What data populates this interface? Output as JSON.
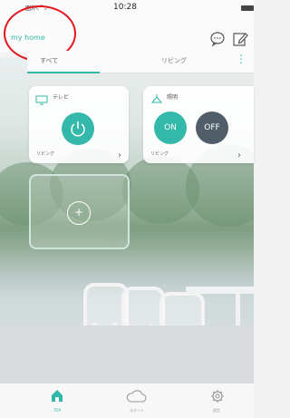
{
  "status_bar": {
    "carrier": "圏外",
    "time": "10:28"
  },
  "header": {
    "home_title": "my home",
    "chat_icon": "chat-bubble-icon",
    "edit_icon": "edit-icon"
  },
  "tabs": [
    {
      "label": "すべて",
      "active": true
    },
    {
      "label": "リビング",
      "active": false
    }
  ],
  "devices": [
    {
      "name": "テレビ",
      "room": "リビング",
      "icon": "tv-icon",
      "control": "power"
    },
    {
      "name": "照明",
      "room": "リビング",
      "icon": "light-icon",
      "control": "on-off",
      "on_label": "ON",
      "off_label": "OFF"
    }
  ],
  "add_device": {
    "icon": "plus-icon"
  },
  "bottom_nav": [
    {
      "label": "TOP",
      "icon": "home-icon",
      "active": true
    },
    {
      "label": "スマート",
      "icon": "cloud-icon",
      "active": false
    },
    {
      "label": "設定",
      "icon": "gear-icon",
      "active": false
    }
  ],
  "colors": {
    "accent": "#31b7a8",
    "off_button": "#4f5e68",
    "annotation": "#e4151c"
  }
}
